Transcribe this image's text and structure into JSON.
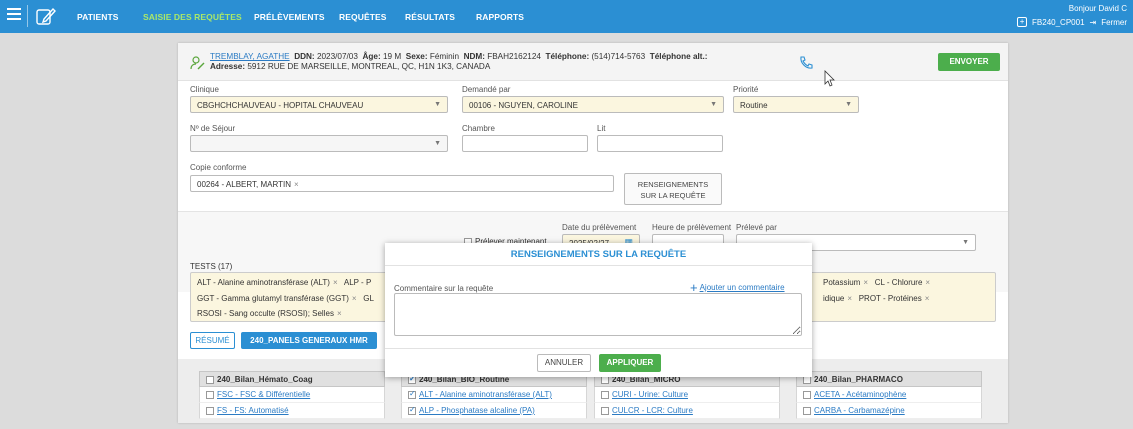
{
  "nav": {
    "items": [
      {
        "label": "PATIENTS",
        "active": false
      },
      {
        "label": "SAISIE DES REQUÊTES",
        "active": true
      },
      {
        "label": "PRÉLÈVEMENTS",
        "active": false
      },
      {
        "label": "REQUÊTES",
        "active": false
      },
      {
        "label": "RÉSULTATS",
        "active": false
      },
      {
        "label": "RAPPORTS",
        "active": false
      }
    ],
    "greeting": "Bonjour David C",
    "site": "FB240_CP001",
    "logout": "Fermer"
  },
  "patient": {
    "name": "TREMBLAY, AGATHE",
    "ddn_label": "DDN:",
    "ddn": "2023/07/03",
    "age_label": "Âge:",
    "age": "19 M",
    "sex_label": "Sexe:",
    "sex": "Féminin",
    "ndm_label": "NDM:",
    "ndm": "FBAH2162124",
    "phone_label": "Téléphone:",
    "phone": "(514)714-5763",
    "phone_alt_label": "Téléphone alt.:",
    "address_label": "Adresse:",
    "address": "5912 RUE DE MARSEILLE, MONTREAL, QC, H1N 1K3, CANADA"
  },
  "actions": {
    "send": "ENVOYER"
  },
  "form": {
    "clinic_label": "Clinique",
    "clinic_value": "CBGHCHCHAUVEAU - HOPITAL CHAUVEAU",
    "requested_by_label": "Demandé par",
    "requested_by_value": "00106 - NGUYEN, CAROLINE",
    "priority_label": "Priorité",
    "priority_value": "Routine",
    "stay_label": "Nº de Séjour",
    "room_label": "Chambre",
    "bed_label": "Lit",
    "cc_label": "Copie conforme",
    "cc_value": "00264 - ALBERT, MARTIN",
    "reqinfo_line1": "RENSEIGNEMENTS",
    "reqinfo_line2": "SUR LA REQUÊTE",
    "collect_now": "Prélever maintenant",
    "collect_date_label": "Date du prélèvement",
    "collect_date_value": "2025/02/27",
    "collect_time_label": "Heure de prélèvement",
    "collected_by_label": "Prélevé par"
  },
  "tests": {
    "label": "TESTS (17)",
    "line1_left": "ALT - Alanine aminotransférase (ALT)",
    "line1_frag": "ALP - P",
    "line1_right": [
      "Potassium",
      "CL - Chlorure"
    ],
    "line2_left": "GGT - Gamma glutamyl transférase (GGT)",
    "line2_frag": "GL",
    "line2_right_a": "idique",
    "line2_right_b": "PROT - Protéines",
    "line3_left": "RSOSI - Sang occulte (RSOSI); Selles"
  },
  "tabs": {
    "summary": "RÉSUMÉ",
    "panels": "240_PANELS GENERAUX HMR"
  },
  "panels": [
    {
      "title": "240_Bilan_Hémato_Coag",
      "checked": false,
      "rows": [
        {
          "text": "FSC - FSC & Différentielle",
          "checked": false
        },
        {
          "text": "FS - FS: Automatisé",
          "checked": false
        }
      ]
    },
    {
      "title": "240_Bilan_BIO_Routine",
      "checked": true,
      "rows": [
        {
          "text": "ALT - Alanine aminotransférase (ALT)",
          "checked": true
        },
        {
          "text": "ALP - Phosphatase alcaline (PA)",
          "checked": true
        }
      ]
    },
    {
      "title": "240_Bilan_MICRO",
      "checked": false,
      "rows": [
        {
          "text": "CURI - Urine: Culture",
          "checked": false
        },
        {
          "text": "CULCR - LCR: Culture",
          "checked": false
        }
      ]
    },
    {
      "title": "240_Bilan_PHARMACO",
      "checked": false,
      "rows": [
        {
          "text": "ACETA - Acétaminophène",
          "checked": false
        },
        {
          "text": "CARBA - Carbamazépine",
          "checked": false
        }
      ]
    }
  ],
  "modal": {
    "title": "RENSEIGNEMENTS SUR LA REQUÊTE",
    "comment_label": "Commentaire sur la requête",
    "add_comment": "Ajouter un commentaire",
    "comment_value": "",
    "cancel": "ANNULER",
    "apply": "APPLIQUER"
  },
  "colors": {
    "nav": "#2b8fd3",
    "active_nav": "#a9e86a",
    "accent": "#2b8fd3",
    "green": "#4cae4c",
    "field_yellow": "#fbf6df"
  },
  "icons": [
    "menu-icon",
    "edit-request-logo-icon",
    "patient-icon",
    "phone-icon",
    "calendar-icon",
    "plus-icon",
    "pointer-cursor-icon"
  ]
}
